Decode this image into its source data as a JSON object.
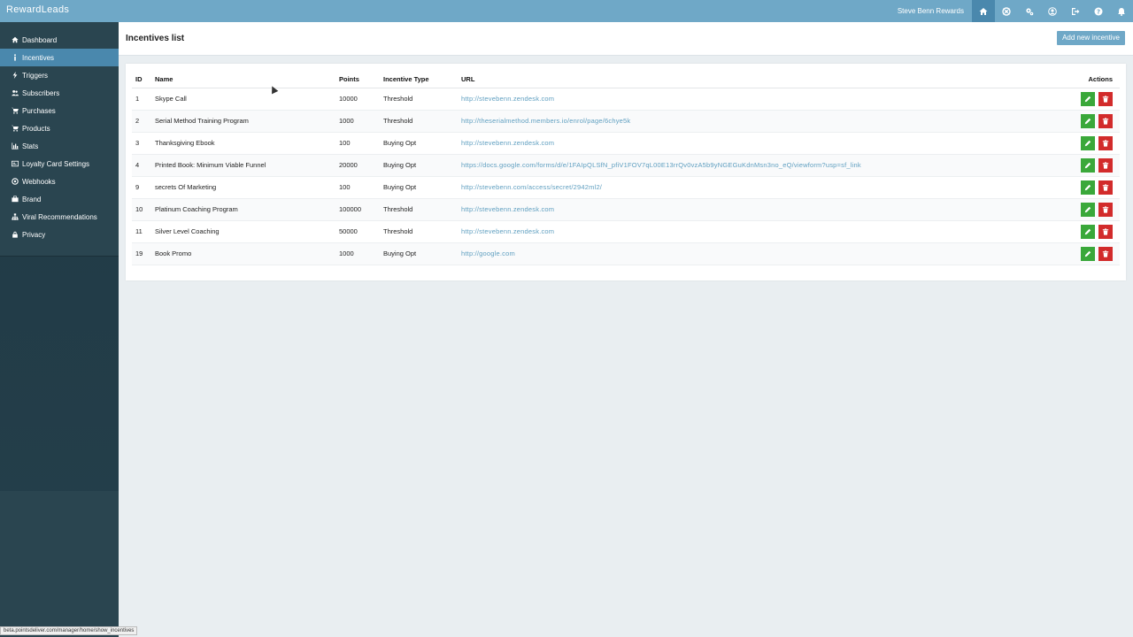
{
  "app": {
    "brand": "RewardLeads",
    "user": "Steve Benn Rewards"
  },
  "topnav_icons": [
    "home-icon",
    "support-icon",
    "settings-icon",
    "user-icon",
    "logout-icon",
    "help-icon",
    "bell-icon"
  ],
  "sidebar": {
    "items": [
      {
        "label": "Dashboard",
        "icon": "home-icon"
      },
      {
        "label": "Incentives",
        "icon": "info-icon"
      },
      {
        "label": "Triggers",
        "icon": "bolt-icon"
      },
      {
        "label": "Subscribers",
        "icon": "users-icon"
      },
      {
        "label": "Purchases",
        "icon": "cart-icon"
      },
      {
        "label": "Products",
        "icon": "cart-icon"
      },
      {
        "label": "Stats",
        "icon": "bar-chart-icon"
      },
      {
        "label": "Loyalty Card Settings",
        "icon": "card-icon"
      },
      {
        "label": "Webhooks",
        "icon": "webhook-icon"
      },
      {
        "label": "Brand",
        "icon": "briefcase-icon"
      },
      {
        "label": "Viral Recommendations",
        "icon": "sitemap-icon"
      },
      {
        "label": "Privacy",
        "icon": "lock-icon"
      }
    ]
  },
  "page": {
    "title": "Incentives list",
    "add_button": "Add new incentive"
  },
  "table": {
    "headers": {
      "id": "ID",
      "name": "Name",
      "points": "Points",
      "type": "Incentive Type",
      "url": "URL",
      "actions": "Actions"
    },
    "rows": [
      {
        "id": "1",
        "name": "Skype Call",
        "points": "10000",
        "type": "Threshold",
        "url": "http://stevebenn.zendesk.com"
      },
      {
        "id": "2",
        "name": "Serial Method Training Program",
        "points": "1000",
        "type": "Threshold",
        "url": "http://theserialmethod.members.io/enrol/page/6chye5k"
      },
      {
        "id": "3",
        "name": "Thanksgiving Ebook",
        "points": "100",
        "type": "Buying Opt",
        "url": "http://stevebenn.zendesk.com"
      },
      {
        "id": "4",
        "name": "Printed Book: Minimum Viable Funnel",
        "points": "20000",
        "type": "Buying Opt",
        "url": "https://docs.google.com/forms/d/e/1FAIpQLSfN_pfiV1FOV7qL00E13rrQv0vzA5b9yNGEGuKdnMsn3no_eQ/viewform?usp=sf_link"
      },
      {
        "id": "9",
        "name": "secrets Of Marketing",
        "points": "100",
        "type": "Buying Opt",
        "url": "http://stevebenn.com/access/secret/2942ml2/"
      },
      {
        "id": "10",
        "name": "Platinum Coaching Program",
        "points": "100000",
        "type": "Threshold",
        "url": "http://stevebenn.zendesk.com"
      },
      {
        "id": "11",
        "name": "Silver Level Coaching",
        "points": "50000",
        "type": "Threshold",
        "url": "http://stevebenn.zendesk.com"
      },
      {
        "id": "19",
        "name": "Book Promo",
        "points": "1000",
        "type": "Buying Opt",
        "url": "http://google.com"
      }
    ]
  },
  "statusbar": {
    "url": "beta.pointsdeliver.com/manager/home/show_incentives"
  },
  "colors": {
    "topbar": "#6fa8c7",
    "active": "#4a88ad",
    "sidebar": "#2a4550",
    "edit": "#3aa83a",
    "delete": "#d22b2b",
    "link": "#5f9fc0"
  }
}
